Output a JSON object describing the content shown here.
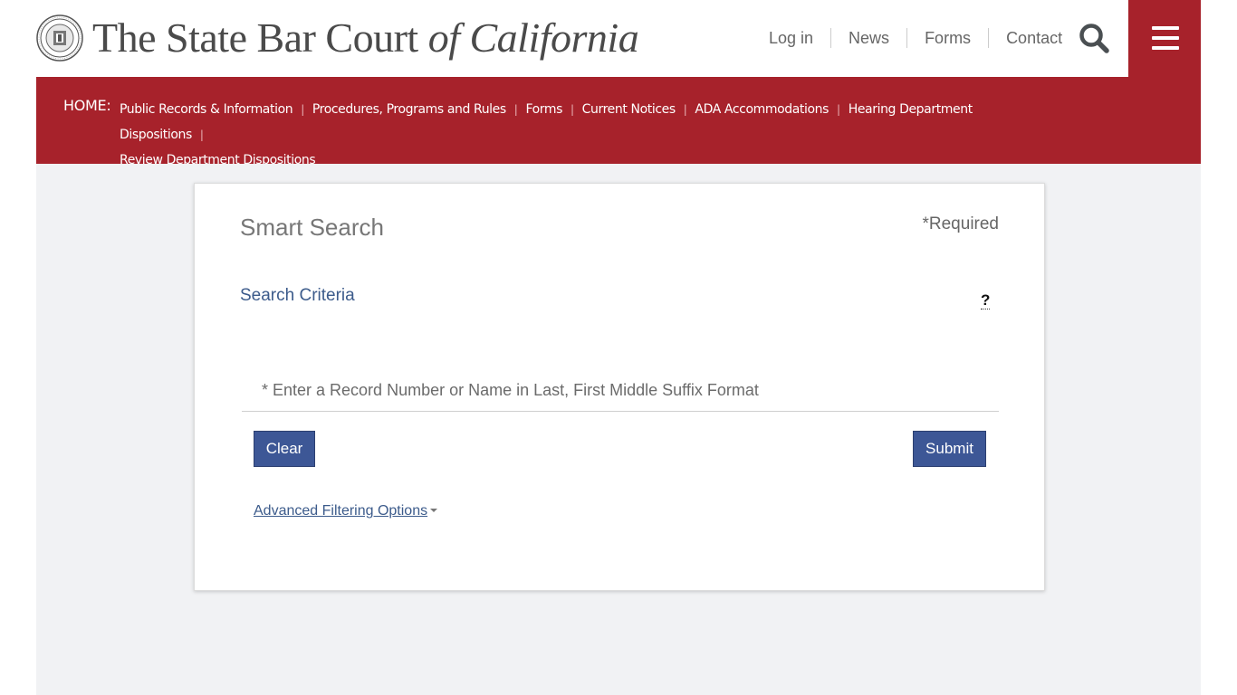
{
  "header": {
    "brand_main": "The State Bar Court ",
    "brand_italic": "of California",
    "top_links": [
      "Log in",
      "News",
      "Forms",
      "Contact"
    ]
  },
  "nav": {
    "home_label": "HOME:",
    "links": [
      "Public Records & Information",
      "Procedures, Programs and Rules",
      "Forms",
      "Current Notices",
      "ADA Accommodations",
      "Hearing Department Dispositions",
      "Review Department Dispositions"
    ]
  },
  "search": {
    "title": "Smart Search",
    "required_label": "*Required",
    "criteria_label": "Search Criteria",
    "help_label": "?",
    "placeholder": "* Enter a Record Number or Name in Last, First Middle Suffix Format",
    "clear_label": "Clear",
    "submit_label": "Submit",
    "advanced_label": "Advanced Filtering Options"
  },
  "colors": {
    "brand_red": "#a7222b",
    "button_blue": "#3d5796",
    "link_blue": "#3c5b8b",
    "content_bg": "#f1f2f4"
  }
}
